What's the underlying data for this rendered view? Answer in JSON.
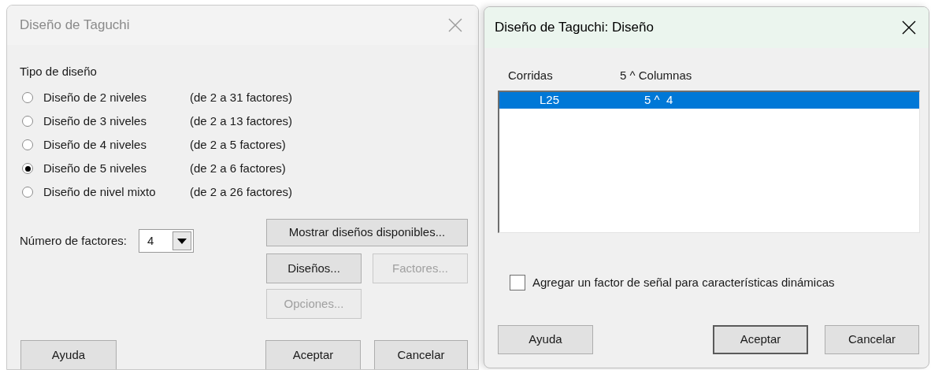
{
  "main_dialog": {
    "title": "Diseño de Taguchi",
    "design_type": {
      "label": "Tipo de diseño",
      "options": [
        {
          "label": "Diseño de 2 niveles",
          "range": "(de 2 a 31 factores)",
          "selected": false
        },
        {
          "label": "Diseño de 3 niveles",
          "range": "(de 2 a 13 factores)",
          "selected": false
        },
        {
          "label": "Diseño de 4 niveles",
          "range": "(de 2 a 5 factores)",
          "selected": false
        },
        {
          "label": "Diseño de 5 niveles",
          "range": "(de 2 a 6 factores)",
          "selected": true
        },
        {
          "label": "Diseño de nivel mixto",
          "range": "(de 2 a 26 factores)",
          "selected": false
        }
      ]
    },
    "factor_count": {
      "label": "Número de factores:",
      "value": "4"
    },
    "side_buttons": [
      {
        "label": "Mostrar diseños disponibles...",
        "disabled": false
      },
      {
        "label": "Diseños...",
        "disabled": false
      },
      {
        "label": "Factores...",
        "disabled": true
      },
      {
        "label": "Opciones...",
        "disabled": true
      }
    ],
    "buttons": [
      {
        "label": "Ayuda"
      },
      {
        "label": "Aceptar"
      },
      {
        "label": "Cancelar"
      }
    ]
  },
  "design_dialog": {
    "title": "Diseño de Taguchi: Diseño",
    "columns": [
      "Corridas",
      "5 ^ Columnas"
    ],
    "rows": [
      {
        "cells": [
          "L25",
          "5 ^  4"
        ],
        "selected": true
      }
    ],
    "checkbox": {
      "label": "Agregar un factor de señal para características dinámicas",
      "checked": false
    },
    "buttons": [
      {
        "label": "Ayuda",
        "default": false
      },
      {
        "label": "Aceptar",
        "default": true
      },
      {
        "label": "Cancelar",
        "default": false
      }
    ]
  }
}
